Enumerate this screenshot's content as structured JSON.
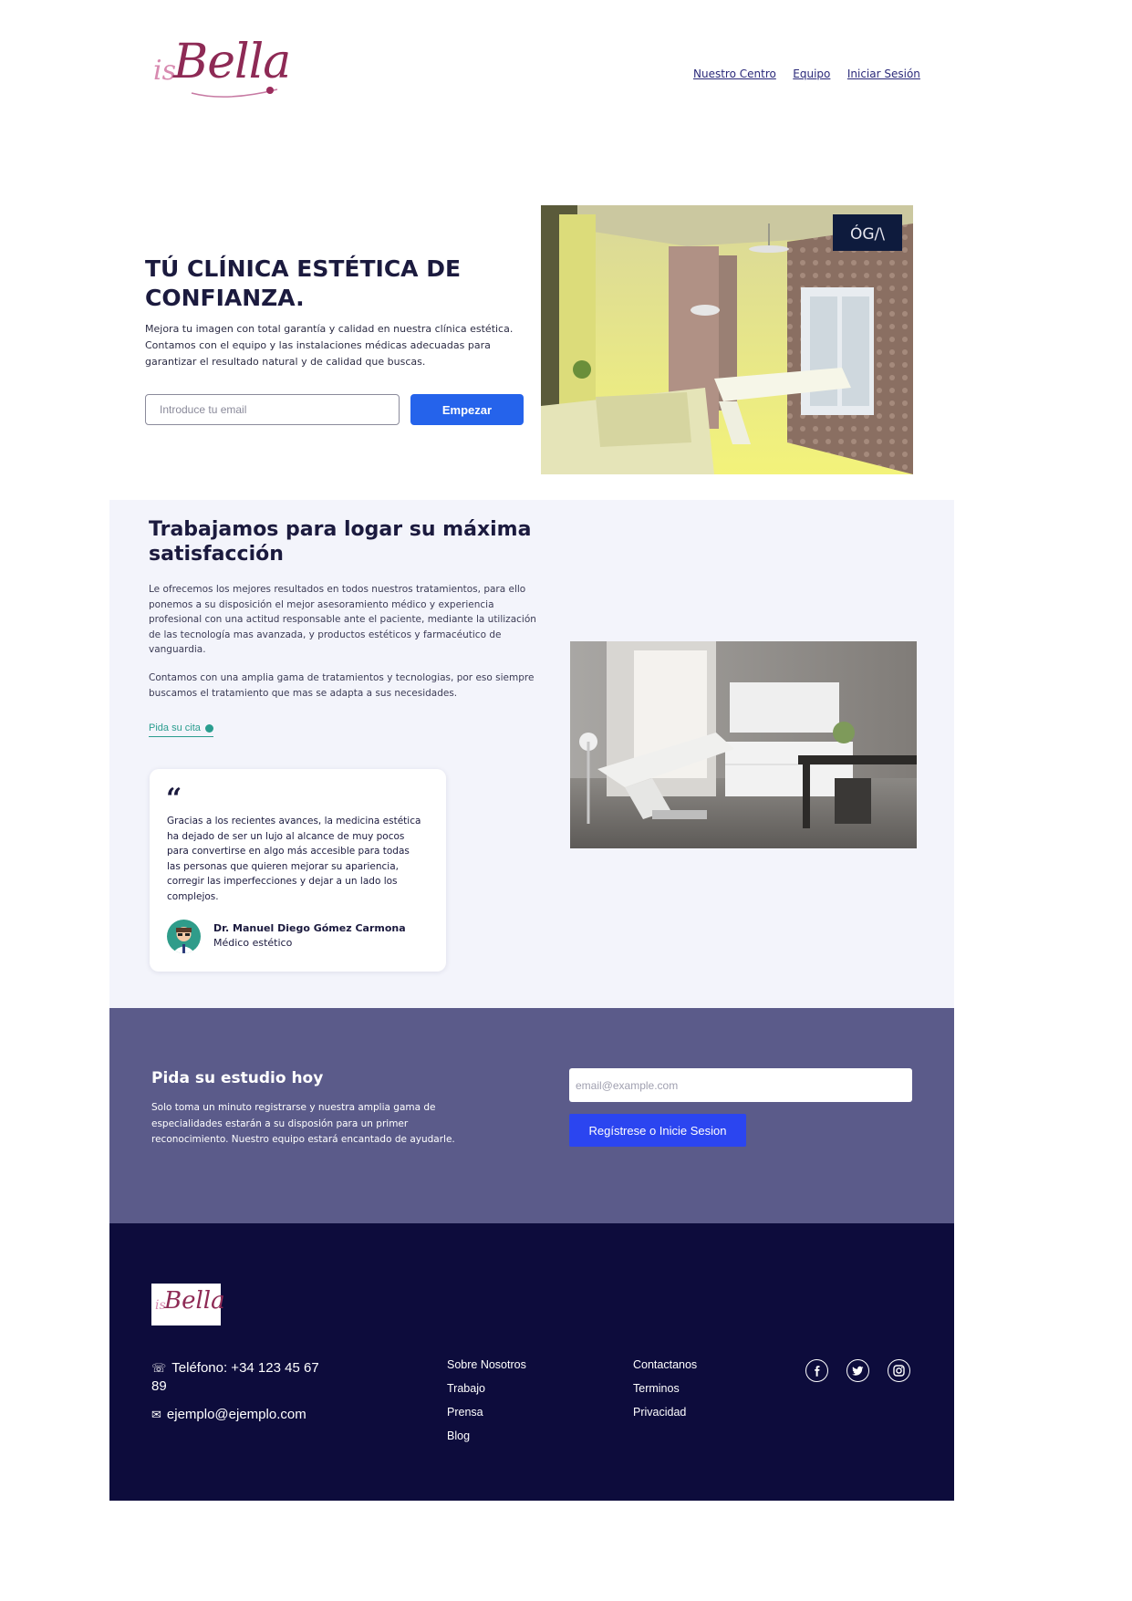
{
  "header": {
    "logo_prefix": "is",
    "logo_name": "Bella",
    "nav": [
      "Nuestro Centro",
      "Equipo",
      "Iniciar Sesión"
    ]
  },
  "hero": {
    "title_line1": "TÚ CLÍNICA ESTÉTICA DE",
    "title_line2": "CONFIANZA.",
    "description": "Mejora tu imagen con total garantía y calidad en nuestra clínica estética. Contamos con el equipo y las instalaciones médicas adecuadas para garantizar el resultado natural y de calidad que buscas.",
    "email_placeholder": "Introduce tu email",
    "button": "Empezar",
    "image_badge": "ÓG/\\"
  },
  "about": {
    "title_line1": "Trabajamos para logar su máxima",
    "title_line2": "satisfacción",
    "paragraph1": "Le ofrecemos los mejores resultados en todos nuestros tratamientos, para ello ponemos a su disposición el mejor asesoramiento médico y experiencia profesional con una actitud responsable ante el paciente, mediante la utilización de las tecnología mas avanzada, y productos estéticos y farmacéutico de vanguardia.",
    "paragraph2": "Contamos con una amplia gama de tratamientos y tecnologias, por eso siempre buscamos el tratamiento que mas se adapta a sus necesidades.",
    "cta": "Pida su cita",
    "quote": {
      "mark": "“",
      "text": "Gracias a los recientes avances, la medicina estética ha dejado de ser un lujo al alcance de muy pocos para convertirse en algo más accesible para todas las personas que quieren mejorar su apariencia, corregir las imperfecciones y dejar a un lado los complejos.",
      "author": "Dr. Manuel Diego Gómez Carmona",
      "role": "Médico estético"
    }
  },
  "signup": {
    "title": "Pida su estudio hoy",
    "description": "Solo toma un minuto registrarse y nuestra amplia gama de especialidades estarán a su disposión para un primer reconocimiento. Nuestro equipo estará encantado de ayudarle.",
    "email_placeholder": "email@example.com",
    "button": "Regístrese o Inicie Sesion"
  },
  "footer": {
    "logo_name": "Bella",
    "logo_prefix": "is",
    "phone_line1": "Teléfono: +34 123 45 67",
    "phone_line2": "89",
    "email": "ejemplo@ejemplo.com",
    "col1": [
      "Sobre Nosotros",
      "Trabajo",
      "Prensa",
      "Blog"
    ],
    "col2": [
      "Contactanos",
      "Terminos",
      "Privacidad"
    ],
    "social": [
      "facebook-icon",
      "twitter-icon",
      "instagram-icon"
    ]
  },
  "colors": {
    "primary_blue": "#2563eb",
    "navy": "#0d0c3c",
    "signup_bg": "#5b5b8a",
    "about_bg": "#f3f4fb",
    "accent_teal": "#2a9d8f",
    "logo_magenta": "#8e2a55"
  }
}
